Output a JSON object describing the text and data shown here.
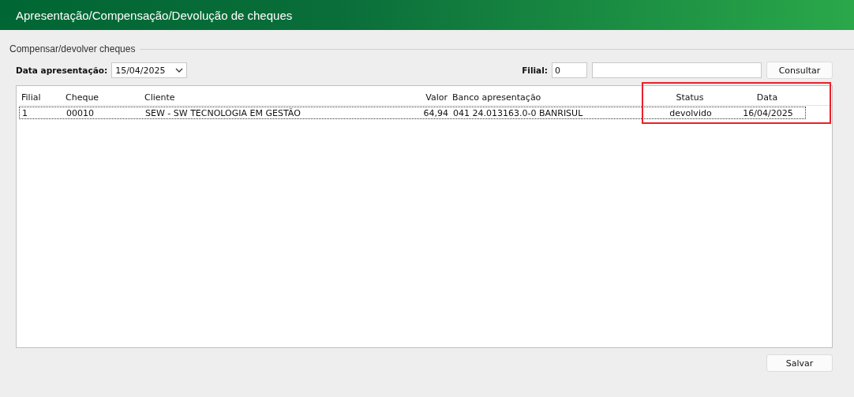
{
  "window": {
    "title": "Apresentação/Compensação/Devolução de cheques"
  },
  "group": {
    "title": "Compensar/devolver cheques"
  },
  "filters": {
    "date_label": "Data apresentação:",
    "date_value": "15/04/2025",
    "branch_label": "Filial:",
    "branch_value": "0",
    "search_button": "Consultar"
  },
  "table": {
    "columns": [
      "Filial",
      "Cheque",
      "Cliente",
      "Valor",
      "Banco apresentação",
      "Status",
      "Data"
    ],
    "rows": [
      {
        "selected": true,
        "cells": [
          "1",
          "00010",
          "SEW - SW TECNOLOGIA EM GESTÃO",
          "64,94",
          "041 24.013163.0-0 BANRISUL",
          "devolvido",
          "16/04/2025"
        ]
      }
    ]
  },
  "save_button": "Salvar"
}
